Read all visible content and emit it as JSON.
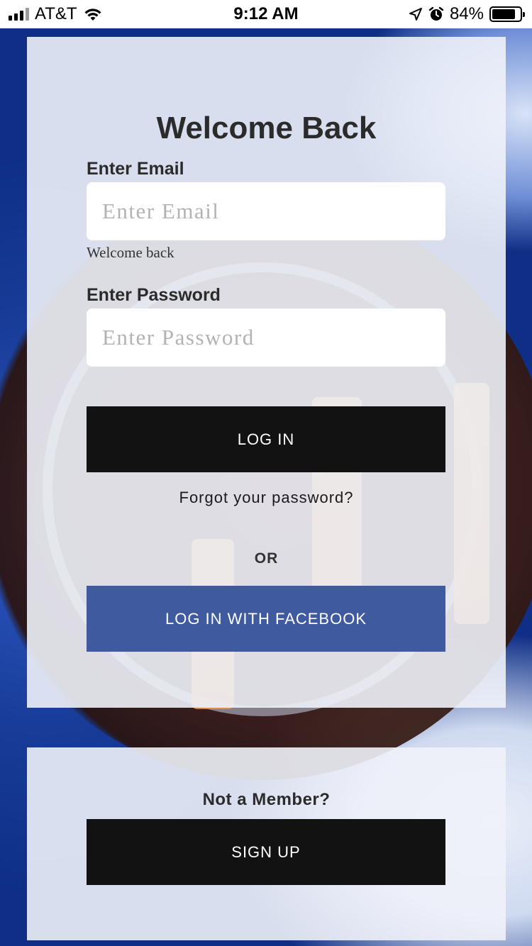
{
  "status_bar": {
    "carrier": "AT&T",
    "time": "9:12 AM",
    "battery_percent": "84%",
    "battery_level": 0.84,
    "icons": [
      "signal-icon",
      "wifi-icon",
      "location-arrow-icon",
      "alarm-clock-icon",
      "battery-icon"
    ]
  },
  "login": {
    "title": "Welcome Back",
    "email_label": "Enter Email",
    "email_placeholder": "Enter Email",
    "email_value": "",
    "email_helper": "Welcome back",
    "password_label": "Enter Password",
    "password_placeholder": "Enter Password",
    "password_value": "",
    "login_button": "LOG IN",
    "forgot_link": "Forgot your password?",
    "or_text": "OR",
    "facebook_button": "LOG IN WITH FACEBOOK"
  },
  "signup": {
    "prompt": "Not a Member?",
    "button": "SIGN UP"
  },
  "colors": {
    "primary_button": "#121212",
    "facebook_button": "#3f5a9e",
    "card_background": "#f0f2fa",
    "background_accent": "#1b3f9a"
  }
}
